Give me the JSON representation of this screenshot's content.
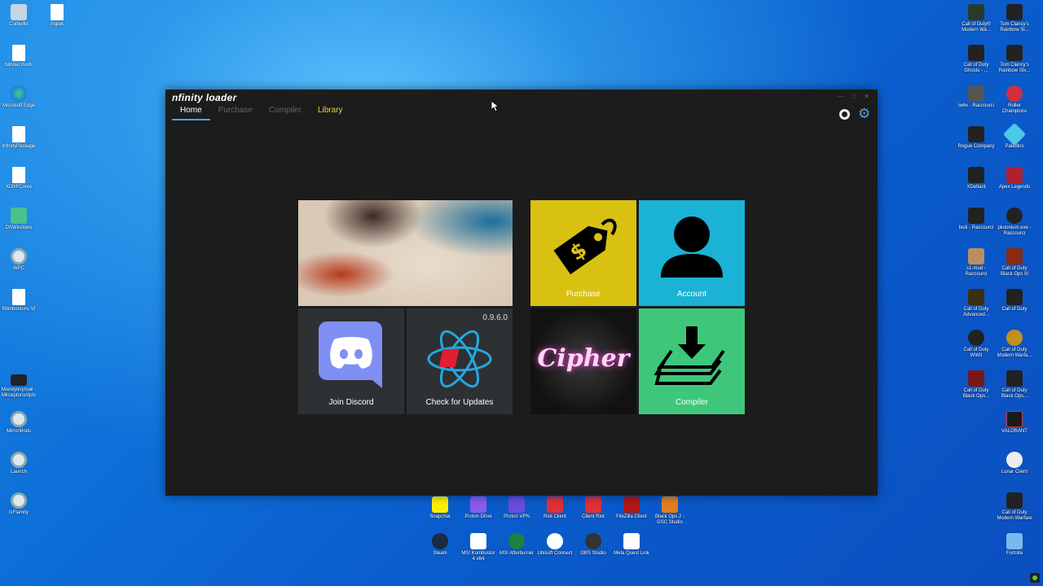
{
  "desktop_left": [
    {
      "label": "Corbeille",
      "icon": "recycle-bin-icon"
    },
    {
      "label": "mgtek",
      "icon": "file-icon"
    },
    {
      "label": "tutorial.mods",
      "icon": "file-icon"
    },
    {
      "label": "Microsoft Edge",
      "icon": "edge-icon"
    },
    {
      "label": "InfinityPackage",
      "icon": "file-icon"
    },
    {
      "label": "XDRFCores",
      "icon": "file-icon"
    },
    {
      "label": "DSWindows",
      "icon": "file-icon"
    },
    {
      "label": "WPC",
      "icon": "gear-icon"
    },
    {
      "label": "Ritmbonions VI",
      "icon": "file-icon"
    },
    {
      "label": "Moneyonymail - Mirceptorscripts",
      "icon": "app-icon"
    },
    {
      "label": "MirrorMods",
      "icon": "gear-icon"
    },
    {
      "label": "Launch",
      "icon": "gear-icon"
    },
    {
      "label": "IcFlamity",
      "icon": "gear-icon"
    }
  ],
  "desktop_right": [
    {
      "label": "Call of Duty® Modern Wa...",
      "icon": "cod-icon"
    },
    {
      "label": "Tom Clancy's Rainbow Si...",
      "icon": "r6-icon"
    },
    {
      "label": "Call of Duty Ghosts - ...",
      "icon": "cod-icon"
    },
    {
      "label": "Tom Clancy's Rainbow Six...",
      "icon": "r6-icon"
    },
    {
      "label": "iw6x - Raccourci",
      "icon": "app-icon"
    },
    {
      "label": "Roller Champions",
      "icon": "app-icon"
    },
    {
      "label": "Rogue Company",
      "icon": "app-icon"
    },
    {
      "label": "Paladins",
      "icon": "app-icon"
    },
    {
      "label": "XDefiant",
      "icon": "app-icon"
    },
    {
      "label": "Apex Legends",
      "icon": "app-icon"
    },
    {
      "label": "boiii - Raccourci",
      "icon": "app-icon"
    },
    {
      "label": "plutonium.exe - Raccourci",
      "icon": "app-icon"
    },
    {
      "label": "s1-mod - Raccourci",
      "icon": "app-icon"
    },
    {
      "label": "Call of Duty Black Ops III",
      "icon": "cod-icon"
    },
    {
      "label": "Call of Duty Advanced...",
      "icon": "cod-icon"
    },
    {
      "label": "Call of Duty",
      "icon": "cod-icon"
    },
    {
      "label": "Call of Duty WWII",
      "icon": "cod-icon"
    },
    {
      "label": "Call of Duty Modern Warfa...",
      "icon": "cod-icon"
    },
    {
      "label": "Call of Duty Black Ops...",
      "icon": "cod-icon"
    },
    {
      "label": "Call of Duty Black Ops...",
      "icon": "cod-icon"
    },
    {
      "label": "VALORANT",
      "icon": "app-icon"
    },
    {
      "label": "Lunar Client",
      "icon": "app-icon"
    },
    {
      "label": "Call of Duty Modern Warfare",
      "icon": "cod-icon"
    },
    {
      "label": "Fortnite",
      "icon": "app-icon"
    }
  ],
  "desktop_bottom": [
    {
      "label": "Snapchat"
    },
    {
      "label": "Proton Drive"
    },
    {
      "label": "Proton VPN"
    },
    {
      "label": "Riot Client"
    },
    {
      "label": "Client Riot"
    },
    {
      "label": "FileZilla Client"
    },
    {
      "label": "Black Ops 2 - GSC Studio"
    },
    {
      "label": "Steam"
    },
    {
      "label": "MSI Kombustor 4 x64"
    },
    {
      "label": "MSI Afterburner"
    },
    {
      "label": "Ubisoft Connect"
    },
    {
      "label": "OBS Studio"
    },
    {
      "label": "Meta Quest Link"
    }
  ],
  "app": {
    "logo": "nfinity loader",
    "tabs": [
      "Home",
      "Purchase",
      "Compiler",
      "Library"
    ],
    "active_tab": "Home",
    "tiles": {
      "purchase": "Purchase",
      "account": "Account",
      "discord": "Join Discord",
      "updates": "Check for Updates",
      "version": "0.9.6.0",
      "cipher": "Cipher",
      "compiler": "Compiler"
    },
    "colors": {
      "purchase": "#d9c112",
      "account": "#1ab3d6",
      "compiler": "#3ec77a",
      "dark_tile": "#2e3133",
      "accent": "#4aa3e8",
      "library": "#f0d04a"
    }
  }
}
